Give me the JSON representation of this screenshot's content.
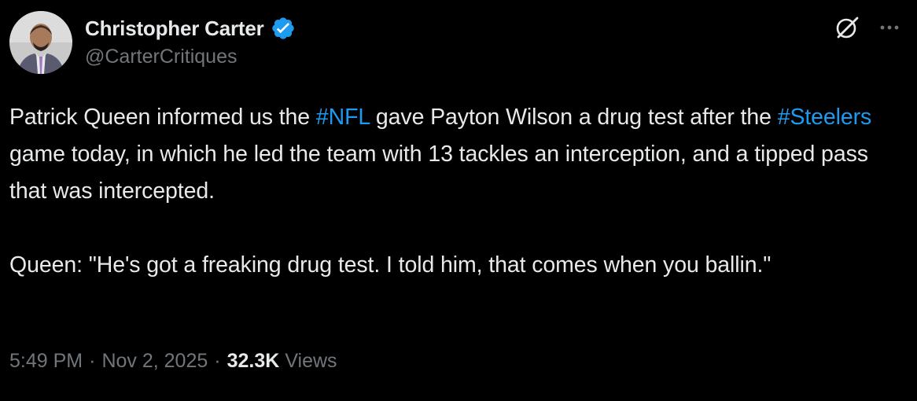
{
  "author": {
    "display_name": "Christopher Carter",
    "handle": "@CarterCritiques",
    "verified": true,
    "badge_color": "#1d9bf0"
  },
  "tweet": {
    "para1": {
      "t1": "Patrick Queen informed us the ",
      "hashtag1": "#NFL",
      "t2": " gave Payton Wilson a drug test after the ",
      "hashtag2": "#Steelers",
      "t3": " game today, in which he led the team with 13 tackles an interception, and a tipped pass that was intercepted."
    },
    "para2": "Queen: \"He's got a freaking drug test. I told him, that comes when you ballin.\"",
    "time": "5:49 PM",
    "separator": "·",
    "date": "Nov 2, 2025",
    "views_count": "32.3K",
    "views_label": "Views"
  },
  "icons": {
    "grok": "grok-icon",
    "more": "more-horizontal-icon",
    "verified": "verified-badge-icon"
  },
  "colors": {
    "background": "#000000",
    "text_primary": "#e7e9ea",
    "text_secondary": "#71767b",
    "link": "#1d9bf0"
  }
}
